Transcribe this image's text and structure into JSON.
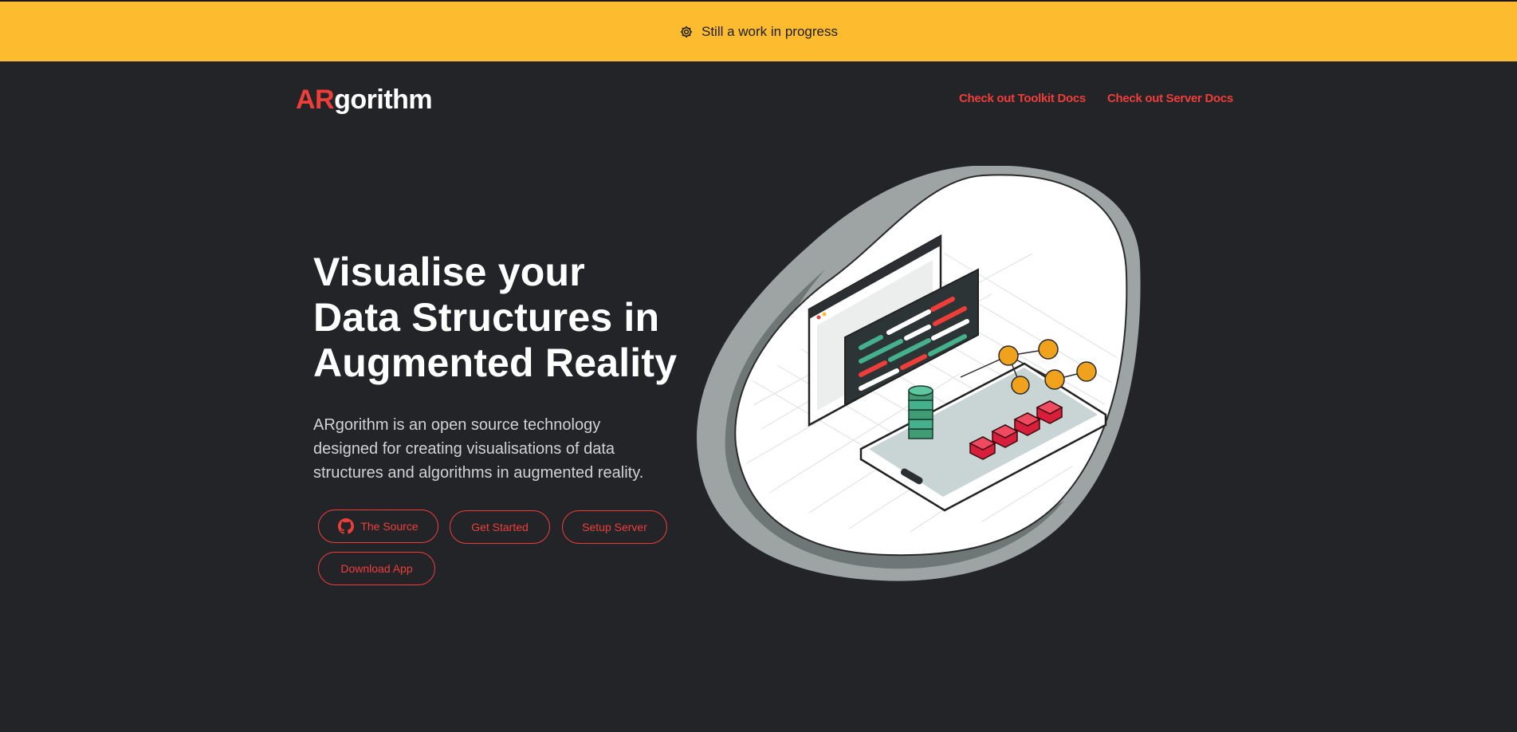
{
  "banner": {
    "icon": "gear-icon",
    "text": "Still a work in progress",
    "bg_color": "#fdbb30"
  },
  "header": {
    "logo_accent": "AR",
    "logo_rest": "gorithm",
    "nav": [
      {
        "label": "Check out Toolkit Docs"
      },
      {
        "label": "Check out Server Docs"
      }
    ]
  },
  "hero": {
    "headline": "Visualise your Data Structures in Augmented Reality",
    "lead": "ARgorithm is an open source technology designed for creating visualisations of data structures and algorithms in augmented reality.",
    "buttons": [
      {
        "label": "The Source",
        "icon": "github-icon"
      },
      {
        "label": "Get Started"
      },
      {
        "label": "Setup Server"
      },
      {
        "label": "Download App"
      }
    ]
  },
  "colors": {
    "accent": "#ef3e3a",
    "background": "#222428",
    "banner": "#fdbb30"
  }
}
